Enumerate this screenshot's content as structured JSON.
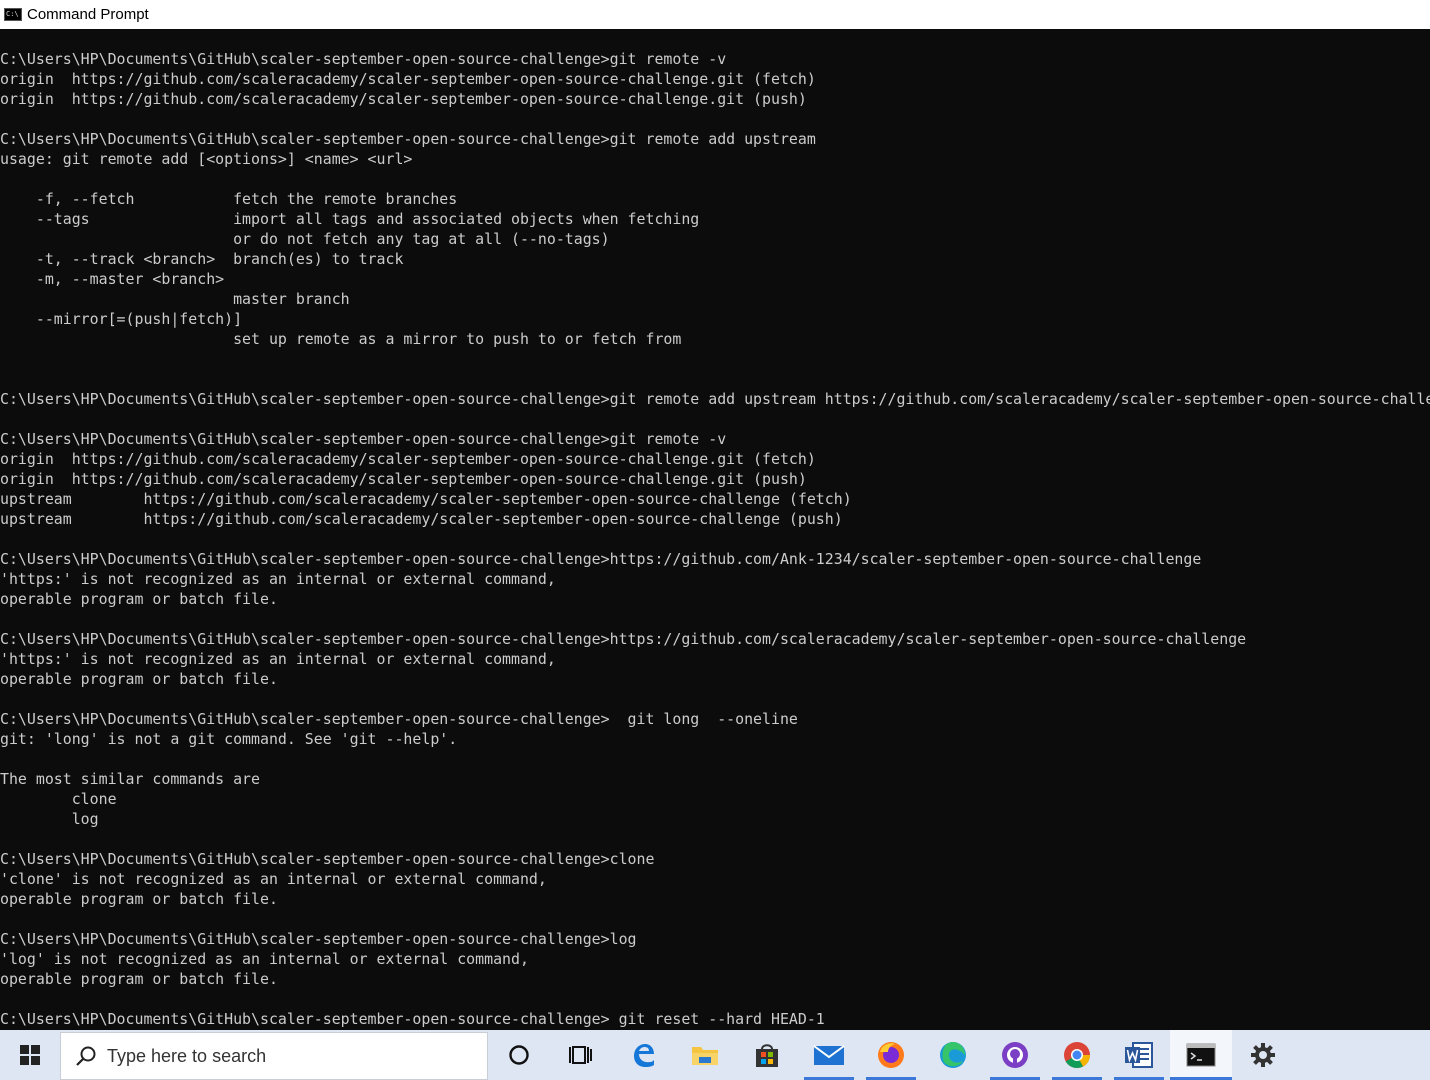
{
  "window": {
    "title": "Command Prompt"
  },
  "console": {
    "lines": [
      "C:\\Users\\HP\\Documents\\GitHub\\scaler-september-open-source-challenge>git remote -v",
      "origin  https://github.com/scaleracademy/scaler-september-open-source-challenge.git (fetch)",
      "origin  https://github.com/scaleracademy/scaler-september-open-source-challenge.git (push)",
      "",
      "C:\\Users\\HP\\Documents\\GitHub\\scaler-september-open-source-challenge>git remote add upstream",
      "usage: git remote add [<options>] <name> <url>",
      "",
      "    -f, --fetch           fetch the remote branches",
      "    --tags                import all tags and associated objects when fetching",
      "                          or do not fetch any tag at all (--no-tags)",
      "    -t, --track <branch>  branch(es) to track",
      "    -m, --master <branch>",
      "                          master branch",
      "    --mirror[=(push|fetch)]",
      "                          set up remote as a mirror to push to or fetch from",
      "",
      "",
      "C:\\Users\\HP\\Documents\\GitHub\\scaler-september-open-source-challenge>git remote add upstream https://github.com/scaleracademy/scaler-september-open-source-challenge",
      "",
      "C:\\Users\\HP\\Documents\\GitHub\\scaler-september-open-source-challenge>git remote -v",
      "origin  https://github.com/scaleracademy/scaler-september-open-source-challenge.git (fetch)",
      "origin  https://github.com/scaleracademy/scaler-september-open-source-challenge.git (push)",
      "upstream        https://github.com/scaleracademy/scaler-september-open-source-challenge (fetch)",
      "upstream        https://github.com/scaleracademy/scaler-september-open-source-challenge (push)",
      "",
      "C:\\Users\\HP\\Documents\\GitHub\\scaler-september-open-source-challenge>https://github.com/Ank-1234/scaler-september-open-source-challenge",
      "'https:' is not recognized as an internal or external command,",
      "operable program or batch file.",
      "",
      "C:\\Users\\HP\\Documents\\GitHub\\scaler-september-open-source-challenge>https://github.com/scaleracademy/scaler-september-open-source-challenge",
      "'https:' is not recognized as an internal or external command,",
      "operable program or batch file.",
      "",
      "C:\\Users\\HP\\Documents\\GitHub\\scaler-september-open-source-challenge>  git long  --oneline",
      "git: 'long' is not a git command. See 'git --help'.",
      "",
      "The most similar commands are",
      "        clone",
      "        log",
      "",
      "C:\\Users\\HP\\Documents\\GitHub\\scaler-september-open-source-challenge>clone",
      "'clone' is not recognized as an internal or external command,",
      "operable program or batch file.",
      "",
      "C:\\Users\\HP\\Documents\\GitHub\\scaler-september-open-source-challenge>log",
      "'log' is not recognized as an internal or external command,",
      "operable program or batch file.",
      "",
      "C:\\Users\\HP\\Documents\\GitHub\\scaler-september-open-source-challenge> git reset --hard HEAD-1"
    ]
  },
  "taskbar": {
    "search_placeholder": "Type here to search",
    "items": [
      {
        "icon": "cortana-circle-icon"
      },
      {
        "icon": "task-view-icon"
      },
      {
        "icon": "edge-legacy-icon"
      },
      {
        "icon": "file-explorer-icon"
      },
      {
        "icon": "microsoft-store-icon"
      },
      {
        "icon": "mail-icon"
      },
      {
        "icon": "firefox-icon"
      },
      {
        "icon": "edge-chromium-icon"
      },
      {
        "icon": "github-desktop-icon"
      },
      {
        "icon": "chrome-icon"
      },
      {
        "icon": "word-icon"
      },
      {
        "icon": "command-prompt-icon",
        "active": true
      },
      {
        "icon": "settings-icon"
      }
    ]
  },
  "colors": {
    "console_bg": "#0c0c0c",
    "console_fg": "#cccccc",
    "taskbar_bg": "#dde6f2",
    "accent": "#3b78d8"
  }
}
